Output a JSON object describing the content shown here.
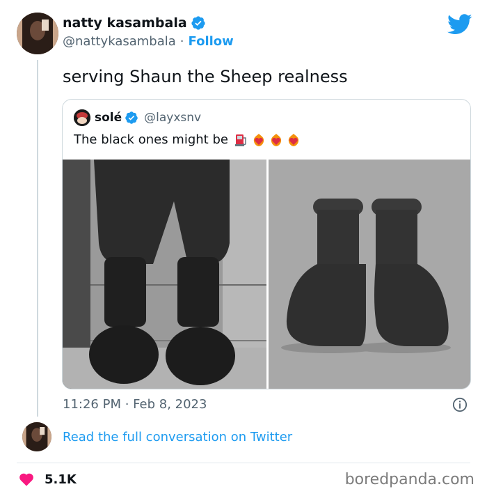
{
  "tweet": {
    "author": {
      "display_name": "natty kasambala",
      "handle": "@nattykasambala",
      "separator": "·",
      "follow_label": "Follow"
    },
    "text": "serving Shaun the Sheep realness",
    "timestamp": "11:26 PM · Feb 8, 2023",
    "read_full_label": "Read the full conversation on Twitter",
    "likes": "5.1K"
  },
  "quoted": {
    "display_name": "solé",
    "handle": "@layxsnv",
    "text": "The black ones might be",
    "emojis": [
      "fuel-pump-emoji",
      "heart-on-fire-emoji",
      "heart-on-fire-emoji",
      "heart-on-fire-emoji"
    ]
  },
  "watermark": "boredpanda.com",
  "colors": {
    "accent": "#1d9bf0",
    "heart": "#f91880",
    "text": "#0f1419",
    "muted": "#536471"
  }
}
